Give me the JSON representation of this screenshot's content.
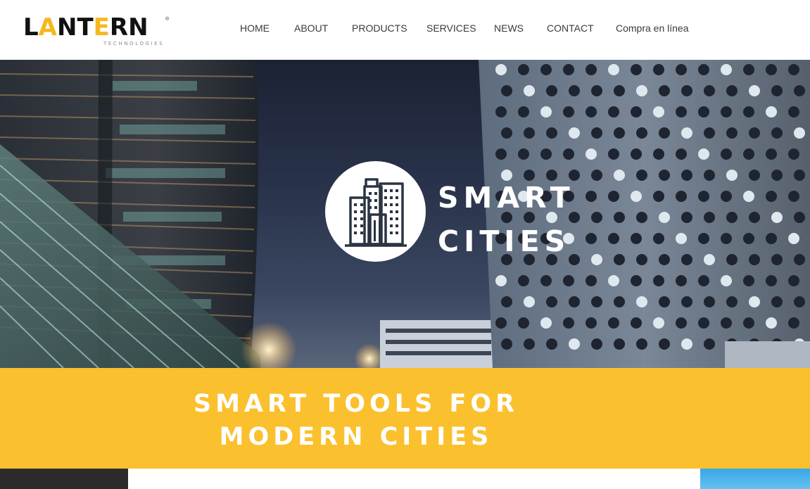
{
  "brand": {
    "name_prefix": "L",
    "name_accent": "A",
    "name_rest": "NT",
    "name_accent2": "E",
    "name_end": "RN",
    "registered_mark": "®",
    "tagline": "TECHNOLOGIES",
    "accent_color": "#f6b81f"
  },
  "nav": {
    "items": [
      {
        "label": "HOME"
      },
      {
        "label": "ABOUT"
      },
      {
        "label": "PRODUCTS"
      },
      {
        "label": "SERVICES"
      },
      {
        "label": "NEWS"
      },
      {
        "label": "CONTACT"
      },
      {
        "label": "Compra en línea"
      }
    ]
  },
  "hero": {
    "icon": "city-buildings-icon",
    "title_line1": "SMART",
    "title_line2": "CITIES"
  },
  "band": {
    "line1": "SMART TOOLS FOR",
    "line2": "MODERN CITIES",
    "color": "#fbc02d"
  }
}
